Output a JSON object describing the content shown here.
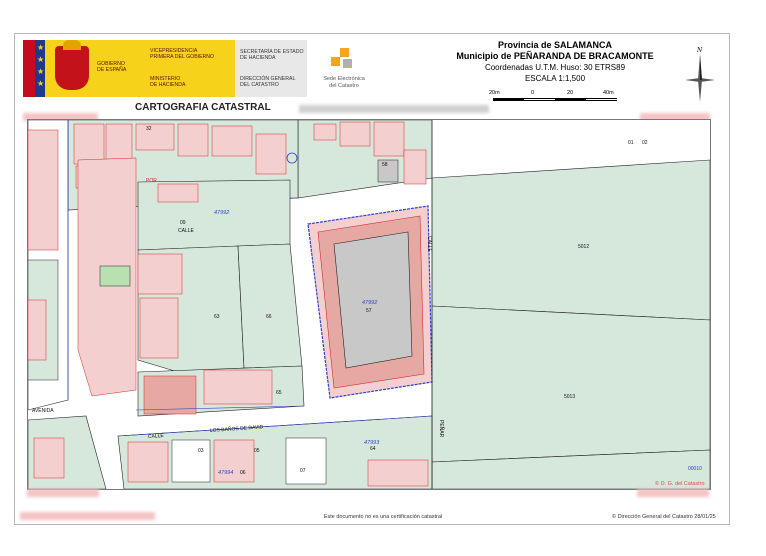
{
  "header": {
    "gobierno": "GOBIERNO\nDE ESPAÑA",
    "gobierno_l1": "GOBIERNO",
    "gobierno_l2": "DE ESPAÑA",
    "vicepresidencia_l1": "VICEPRESIDENCIA",
    "vicepresidencia_l2": "PRIMERA DEL GOBIERNO",
    "ministerio_l1": "MINISTERIO",
    "ministerio_l2": "DE HACIENDA",
    "secretaria_l1": "SECRETARÍA DE ESTADO",
    "secretaria_l2": "DE HACIENDA",
    "direccion_l1": "DIRECCIÓN GENERAL",
    "direccion_l2": "DEL CATASTRO",
    "sede_l1": "Sede Electrónica",
    "sede_l2": "del Catastro",
    "provincia": "Provincia de SALAMANCA",
    "municipio": "Municipio de PEÑARANDA DE BRACAMONTE",
    "coordenadas": "Coordenadas U.T.M. Huso: 30 ETRS89",
    "escala": "ESCALA 1:1,500",
    "scale_labels": [
      "20m",
      "0",
      "20",
      "40m"
    ],
    "north": "N",
    "carto_title": "CARTOGRAFIA CATASTRAL"
  },
  "map": {
    "labels": {
      "parcel_5012a": "5012",
      "parcel_5012b": "5013",
      "parcel_57": "57",
      "parcel_58": "58",
      "parcel_09": "09",
      "parcel_63": "63",
      "parcel_66": "66",
      "parcel_65": "65",
      "parcel_64": "64",
      "parcel_03": "03",
      "parcel_07": "07",
      "parcel_06": "06",
      "parcel_05": "05",
      "parcel_32": "32",
      "parcel_01": "01",
      "parcel_02": "02",
      "block_47992a": "47992",
      "block_47992b": "47992",
      "block_47993": "47993",
      "block_47994": "47994",
      "street_calle1": "CALLE",
      "street_banos": "LOS BAÑOS DE DAVID",
      "street_calle2": "CALLE",
      "street_penar": "PEÑAR",
      "street_calle3": "CALLE",
      "street_avenida": "AVENIDA",
      "street_por": "POR",
      "parcel_00010": "00010",
      "copyright": "© D. G. del Catastro"
    }
  },
  "footer": {
    "note": "Este documento no es una certificación catastral",
    "copyright": "© Dirección General del Catastro 28/01/25"
  },
  "colors": {
    "parcel_green": "#d6e7dc",
    "building_pink": "#f4cfcf",
    "building_red": "#e6a8a2",
    "street_white": "#ffffff",
    "line_red": "#d22b2b",
    "line_blue": "#3040c8",
    "line_black": "#222222",
    "highlight_grey": "#c8c8c8"
  }
}
